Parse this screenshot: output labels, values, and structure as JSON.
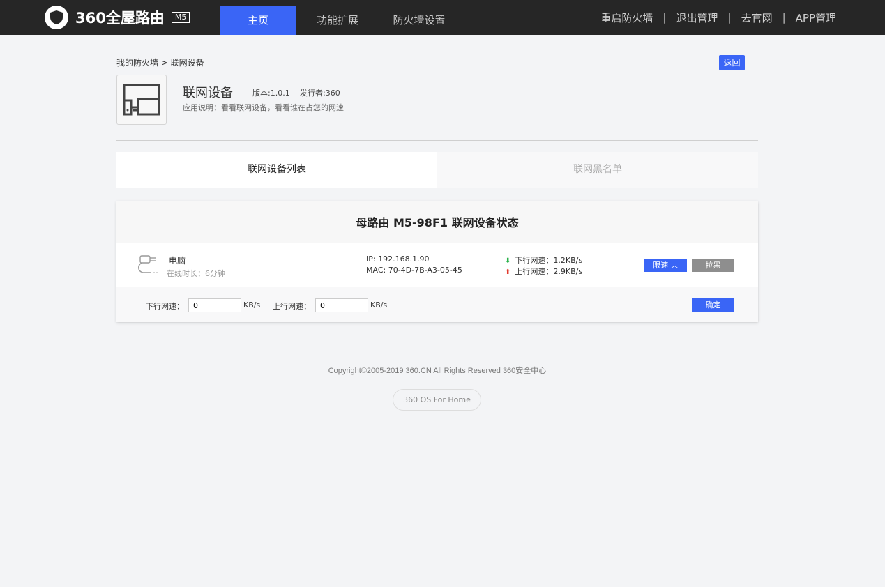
{
  "header": {
    "logo_text": "360全屋路由",
    "model_badge": "M5",
    "nav": [
      {
        "label": "主页",
        "active": true
      },
      {
        "label": "功能扩展",
        "active": false
      },
      {
        "label": "防火墙设置",
        "active": false
      }
    ],
    "right_links": [
      "重启防火墙",
      "退出管理",
      "去官网",
      "APP管理"
    ],
    "accent_color": "#3a65f6"
  },
  "breadcrumb": "我的防火墙 > 联网设备",
  "back_button": "返回",
  "app": {
    "icon": "network-device-icon",
    "title": "联网设备",
    "version": "版本:1.0.1",
    "publisher": "发行者:360",
    "description": "应用说明：看看联网设备，看看谁在占您的网速"
  },
  "tabs": [
    {
      "label": "联网设备列表",
      "active": true
    },
    {
      "label": "联网黑名单",
      "active": false
    }
  ],
  "status_card": {
    "title": "母路由 M5-98F1 联网设备状态",
    "device": {
      "icon": "wired-plug-icon",
      "name": "电脑",
      "online": "在线时长：6分钟",
      "ip": "IP: 192.168.1.90",
      "mac": "MAC: 70-4D-7B-A3-05-45",
      "down": "下行网速：1.2KB/s",
      "up": "上行网速：2.9KB/s",
      "limit_button": "限速 ︿",
      "block_button": "拉黑"
    },
    "limit_form": {
      "down_label": "下行网速：",
      "down_value": "0",
      "down_unit": "KB/s",
      "up_label": "上行网速：",
      "up_value": "0",
      "up_unit": "KB/s",
      "confirm_button": "确定"
    }
  },
  "footer": {
    "copyright": "Copyright©2005-2019 360.CN All Rights Reserved 360安全中心",
    "os_badge": "360 OS For Home"
  }
}
